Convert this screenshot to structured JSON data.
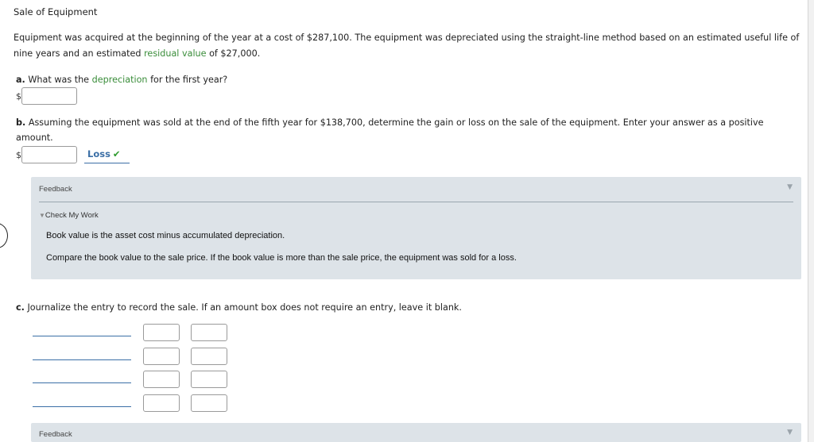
{
  "problem": {
    "title": "Sale of Equipment",
    "intro_part1": "Equipment was acquired at the beginning of the year at a cost of $287,100. The equipment was depreciated using the straight-line method based on an estimated useful life of nine years and an estimated ",
    "intro_link": "residual value",
    "intro_part2": " of $27,000."
  },
  "part_a": {
    "letter": "a.",
    "prefix": " What was the ",
    "link": "depreciation",
    "suffix": " for the first year?",
    "currency": "$",
    "value": ""
  },
  "part_b": {
    "letter": "b.",
    "line1": " Assuming the equipment was sold at the end of the fifth year for $138,700, determine the gain or loss on the sale of the equipment. Enter your answer as a positive",
    "line2": "amount.",
    "currency": "$",
    "value": "",
    "selection": "Loss",
    "check_glyph": "✔"
  },
  "feedback_1": {
    "label": "Feedback",
    "arrow": "▼",
    "check_my_work_glyph": "▼",
    "check_my_work": "Check My Work",
    "line1": "Book value is the asset cost minus accumulated depreciation.",
    "line2": "Compare the book value to the sale price. If the book value is more than the sale price, the equipment was sold for a loss."
  },
  "part_c": {
    "letter": "c.",
    "text": " Journalize the entry to record the sale. If an amount box does not require an entry, leave it blank.",
    "rows": [
      {
        "account": "",
        "debit": "",
        "credit": ""
      },
      {
        "account": "",
        "debit": "",
        "credit": ""
      },
      {
        "account": "",
        "debit": "",
        "credit": ""
      },
      {
        "account": "",
        "debit": "",
        "credit": ""
      }
    ]
  },
  "feedback_2": {
    "label": "Feedback",
    "arrow": "▼"
  }
}
